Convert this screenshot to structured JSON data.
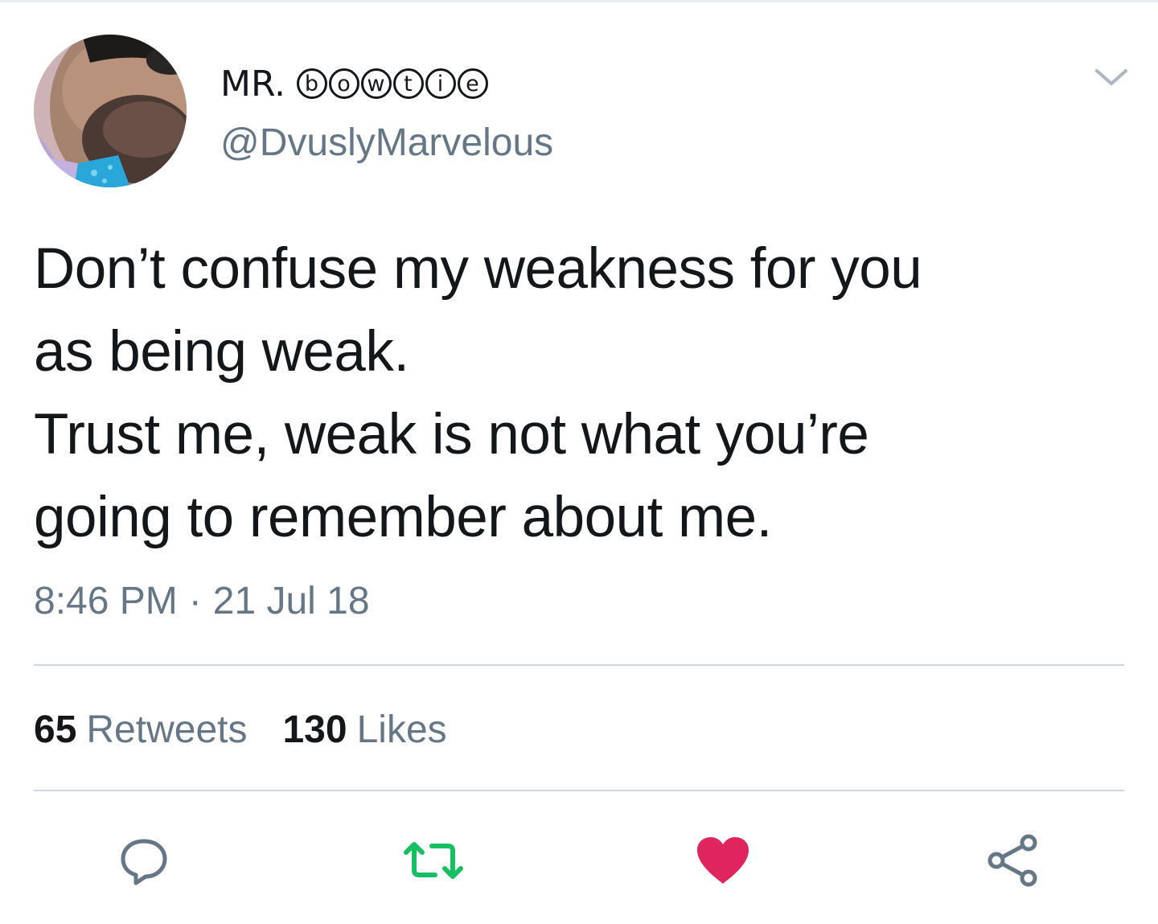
{
  "user": {
    "name_prefix": "MR.",
    "name_circled": [
      "b",
      "o",
      "w",
      "t",
      "i",
      "e"
    ],
    "handle": "@DvuslyMarvelous"
  },
  "tweet": {
    "text": "Don’t confuse my weakness for you\nas being weak.\nTrust me, weak is not what you’re\ngoing to remember about me.",
    "time": "8:46 PM",
    "separator": "·",
    "date": "21 Jul 18"
  },
  "stats": {
    "retweets_count": "65",
    "retweets_label": "Retweets",
    "likes_count": "130",
    "likes_label": "Likes"
  },
  "actions": {
    "reply_icon": "reply-icon",
    "retweet_icon": "retweet-icon",
    "like_icon": "heart-icon",
    "share_icon": "share-icon",
    "retweeted": true,
    "liked": true
  },
  "colors": {
    "retweet_active": "#17bf63",
    "like_active": "#e0245e",
    "secondary_text": "#657786",
    "icon_gray": "#657786",
    "divider": "#ccd6dd"
  }
}
